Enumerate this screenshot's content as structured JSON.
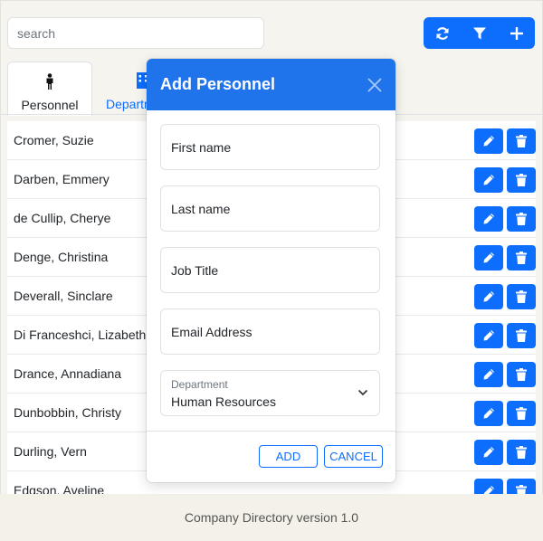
{
  "search": {
    "placeholder": "search"
  },
  "toolbar": {
    "icons": [
      "refresh-icon",
      "filter-icon",
      "plus-icon"
    ]
  },
  "tabs": [
    {
      "label": "Personnel",
      "icon": "person-icon",
      "active": true
    },
    {
      "label": "Departments",
      "icon": "building-icon",
      "active": false
    }
  ],
  "personnel": [
    {
      "name": "Cromer, Suzie"
    },
    {
      "name": "Darben, Emmery"
    },
    {
      "name": "de Cullip, Cherye"
    },
    {
      "name": "Denge, Christina"
    },
    {
      "name": "Deverall, Sinclare"
    },
    {
      "name": "Di Franceshci, Lizabeth"
    },
    {
      "name": "Drance, Annadiana"
    },
    {
      "name": "Dunbobbin, Christy"
    },
    {
      "name": "Durling, Vern"
    },
    {
      "name": "Edgson, Aveline"
    }
  ],
  "modal": {
    "title": "Add Personnel",
    "fields": {
      "first_name": "First name",
      "last_name": "Last name",
      "job_title": "Job Title",
      "email": "Email Address"
    },
    "department": {
      "caption": "Department",
      "value": "Human Resources"
    },
    "add_label": "ADD",
    "cancel_label": "CANCEL"
  },
  "footer": {
    "text": "Company Directory version 1.0"
  },
  "colors": {
    "primary": "#0d6efd",
    "modal_header": "#1f74ec",
    "footer_bg": "#f4f1e8"
  }
}
